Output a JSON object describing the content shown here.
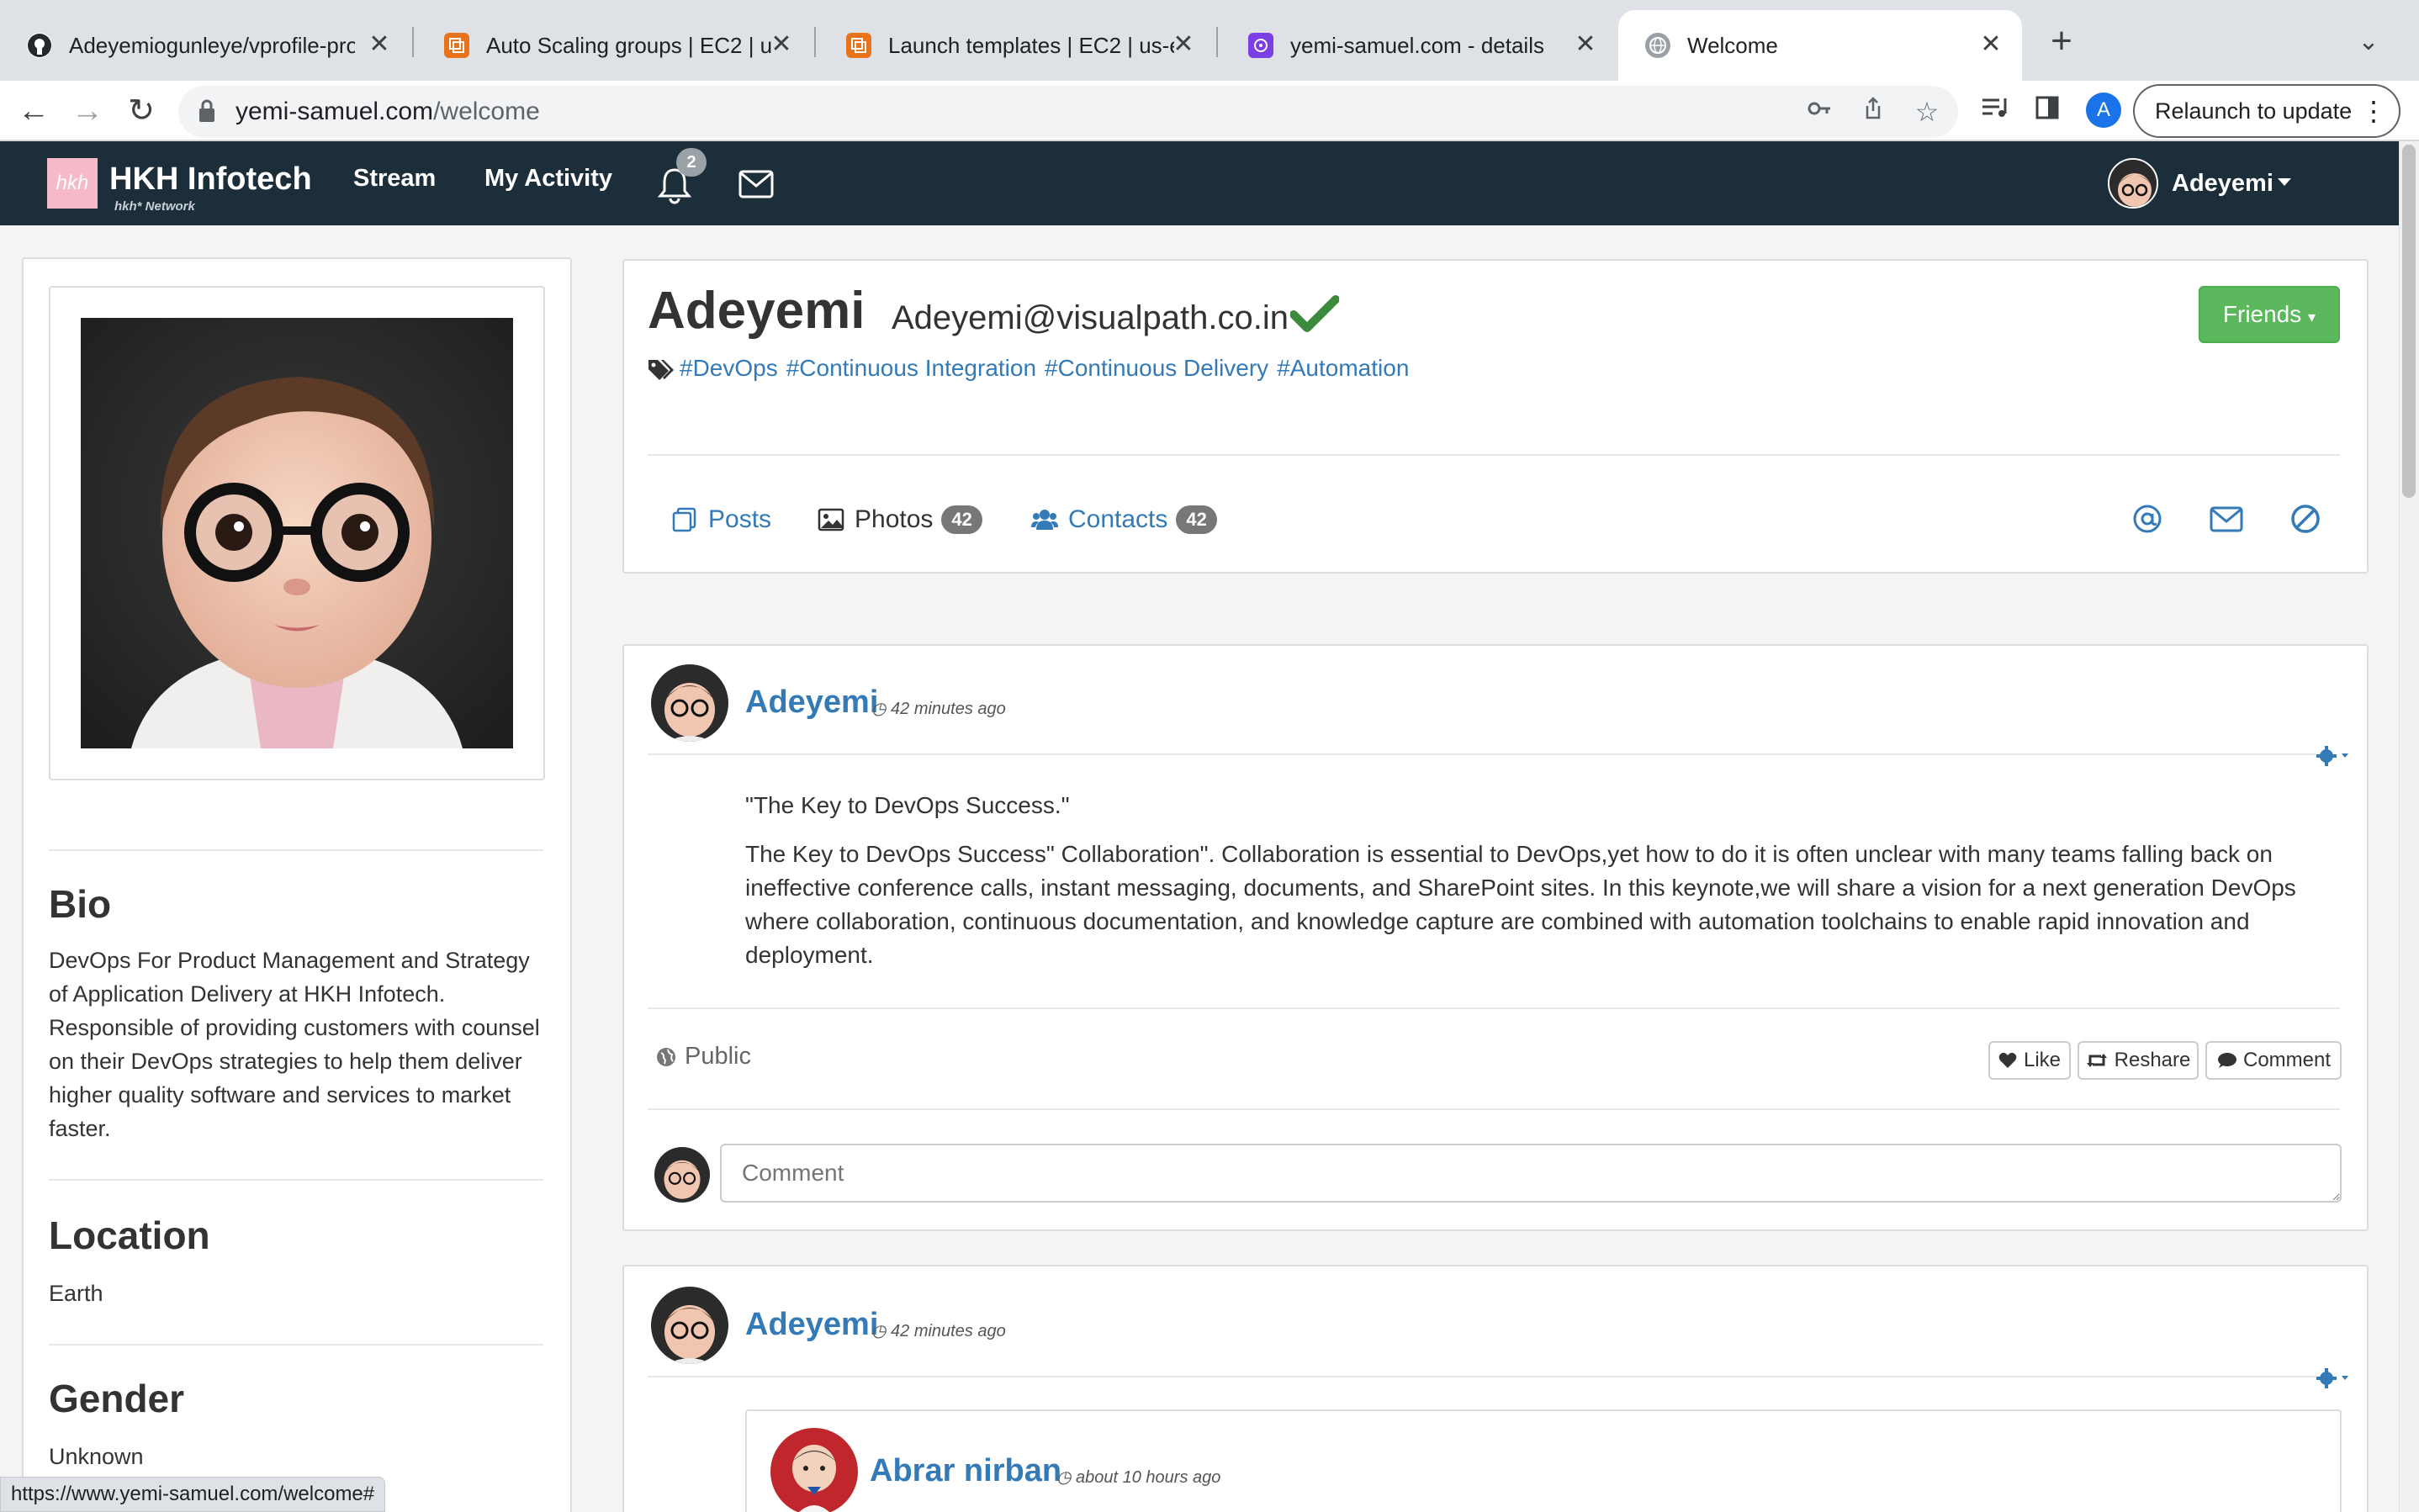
{
  "browser": {
    "tabs": [
      {
        "title": "Adeyemiogunleye/vprofile-pro",
        "favicon": "github-icon"
      },
      {
        "title": "Auto Scaling groups | EC2 | us",
        "favicon": "aws-icon"
      },
      {
        "title": "Launch templates | EC2 | us-e",
        "favicon": "aws-icon"
      },
      {
        "title": "yemi-samuel.com - details",
        "favicon": "route53-icon"
      },
      {
        "title": "Welcome",
        "favicon": "globe-icon"
      }
    ],
    "active_tab": 4,
    "url_host": "yemi-samuel.com",
    "url_path": "/welcome",
    "relaunch_label": "Relaunch to update",
    "profile_initial": "A",
    "status_url": "https://www.yemi-samuel.com/welcome#"
  },
  "navbar": {
    "logo_text": "hkh",
    "brand": "HKH Infotech",
    "brand_sub": "hkh* Network",
    "links": [
      "Stream",
      "My Activity"
    ],
    "notification_count": "2",
    "user_name": "Adeyemi"
  },
  "sidebar": {
    "bio_heading": "Bio",
    "bio_text": "DevOps For Product Management and Strategy of Application Delivery at HKH Infotech. Responsible of providing customers with counsel on their DevOps strategies to help them deliver higher quality software and services to market faster.",
    "location_heading": "Location",
    "location_text": "Earth",
    "gender_heading": "Gender",
    "gender_text": "Unknown"
  },
  "profile": {
    "name": "Adeyemi",
    "email": "Adeyemi@visualpath.co.in",
    "tags": [
      "#DevOps",
      "#Continuous Integration",
      "#Continuous Delivery",
      "#Automation"
    ],
    "friends_label": "Friends",
    "tabs": {
      "posts": "Posts",
      "photos": "Photos",
      "photos_count": "42",
      "contacts": "Contacts",
      "contacts_count": "42"
    }
  },
  "posts": [
    {
      "author": "Adeyemi",
      "time": "42 minutes ago",
      "title": "\"The Key to DevOps Success.\"",
      "body": "The Key to DevOps Success\" Collaboration\". Collaboration is essential to DevOps,yet how to do it is often unclear with many teams falling back on ineffective conference calls, instant messaging, documents, and SharePoint sites. In this keynote,we will share a vision for a next generation DevOps where collaboration, continuous documentation, and knowledge capture are combined with automation toolchains to enable rapid innovation and deployment.",
      "visibility": "Public",
      "actions": {
        "like": "Like",
        "reshare": "Reshare",
        "comment": "Comment"
      },
      "comment_placeholder": "Comment"
    },
    {
      "author": "Adeyemi",
      "time": "42 minutes ago",
      "reshared_author": "Abrar nirban",
      "reshared_time": "about 10 hours ago"
    }
  ],
  "colors": {
    "navbar": "#1c2e3a",
    "link": "#337ab7",
    "success": "#5cb85c",
    "verified": "#3c8a3c"
  }
}
